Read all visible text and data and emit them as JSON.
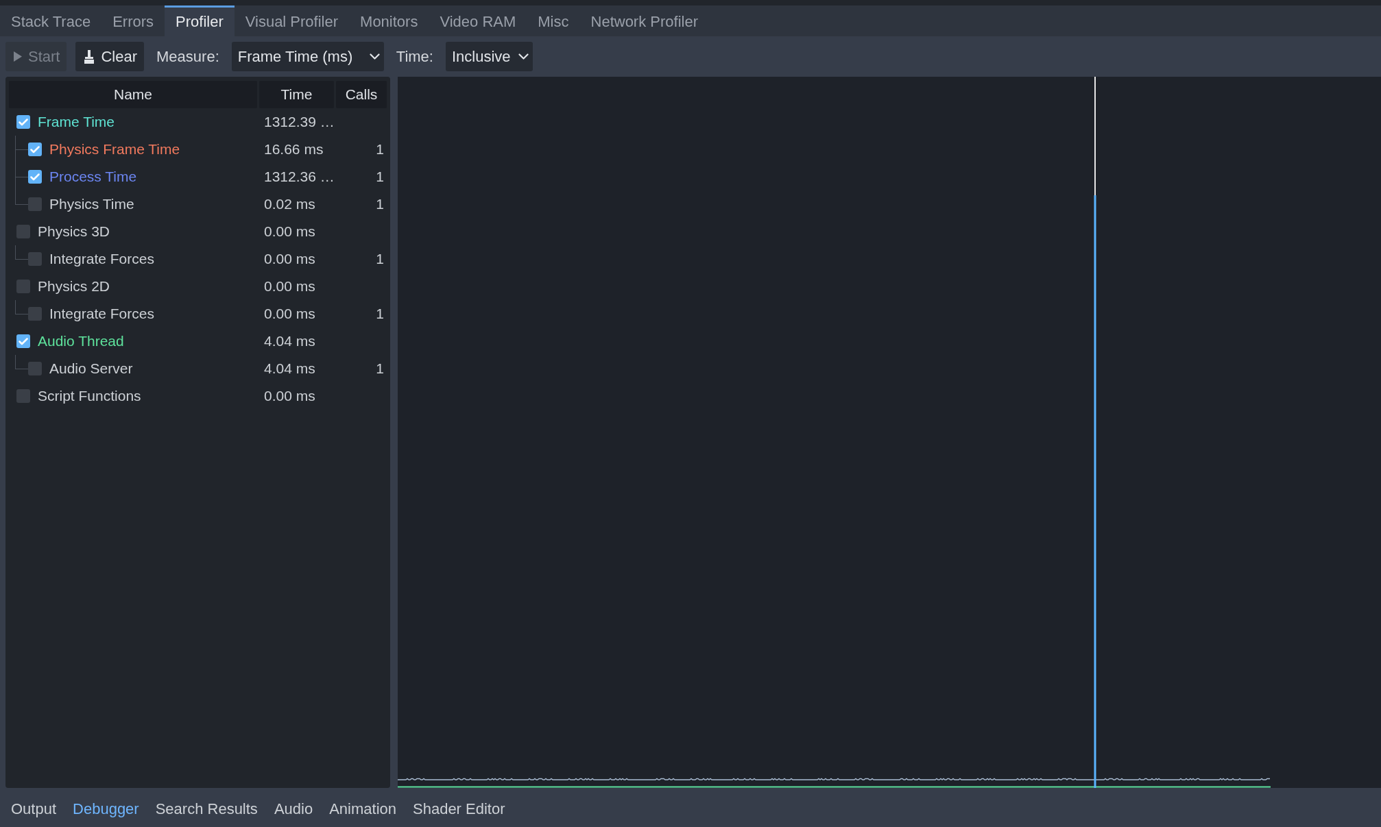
{
  "tabs": [
    {
      "label": "Stack Trace",
      "selected": false
    },
    {
      "label": "Errors",
      "selected": false
    },
    {
      "label": "Profiler",
      "selected": true
    },
    {
      "label": "Visual Profiler",
      "selected": false
    },
    {
      "label": "Monitors",
      "selected": false
    },
    {
      "label": "Video RAM",
      "selected": false
    },
    {
      "label": "Misc",
      "selected": false
    },
    {
      "label": "Network Profiler",
      "selected": false
    }
  ],
  "toolbar": {
    "start_button": {
      "label": "Start",
      "disabled": true
    },
    "clear_button": {
      "label": "Clear"
    },
    "measure": {
      "label": "Measure:",
      "value": "Frame Time (ms)"
    },
    "time": {
      "label": "Time:",
      "value": "Inclusive"
    }
  },
  "tree": {
    "columns": [
      "Name",
      "Time",
      "Calls"
    ],
    "items": [
      {
        "name": "Frame Time",
        "time": "1312.39 …",
        "checked": true,
        "color": "#5fe3d3",
        "children": [
          {
            "name": "Physics Frame Time",
            "time": "16.66 ms",
            "calls": "1",
            "checked": true,
            "color": "#f27a5e"
          },
          {
            "name": "Process Time",
            "time": "1312.36 …",
            "calls": "1",
            "checked": true,
            "color": "#6c86f2"
          },
          {
            "name": "Physics Time",
            "time": "0.02 ms",
            "calls": "1",
            "checked": false
          }
        ]
      },
      {
        "name": "Physics 3D",
        "time": "0.00 ms",
        "checked": false,
        "children": [
          {
            "name": "Integrate Forces",
            "time": "0.00 ms",
            "calls": "1",
            "checked": false
          }
        ]
      },
      {
        "name": "Physics 2D",
        "time": "0.00 ms",
        "checked": false,
        "children": [
          {
            "name": "Integrate Forces",
            "time": "0.00 ms",
            "calls": "1",
            "checked": false
          }
        ]
      },
      {
        "name": "Audio Thread",
        "time": "4.04 ms",
        "checked": true,
        "color": "#5ee29c",
        "children": [
          {
            "name": "Audio Server",
            "time": "4.04 ms",
            "calls": "1",
            "checked": false
          }
        ]
      },
      {
        "name": "Script Functions",
        "time": "0.00 ms",
        "checked": false
      }
    ]
  },
  "bottom_tabs": [
    {
      "label": "Output",
      "selected": false
    },
    {
      "label": "Debugger",
      "selected": true
    },
    {
      "label": "Search Results",
      "selected": false
    },
    {
      "label": "Audio",
      "selected": false
    },
    {
      "label": "Animation",
      "selected": false
    },
    {
      "label": "Shader Editor",
      "selected": false
    }
  ]
}
